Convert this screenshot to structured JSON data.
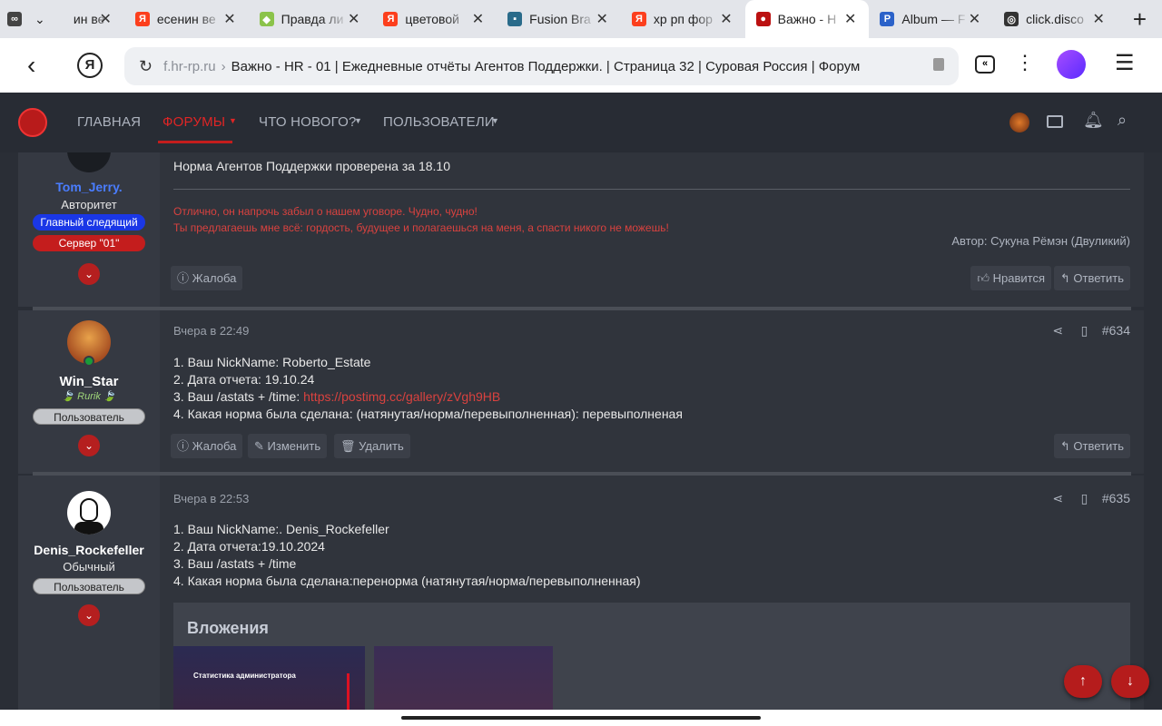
{
  "tabs": [
    {
      "title": "ин ве",
      "fav": "∞",
      "favbg": "#444"
    },
    {
      "title": "есенин ве",
      "fav": "Я",
      "favbg": "#fc3f1d"
    },
    {
      "title": "Правда ли",
      "fav": "◆",
      "favbg": "#8bc34a"
    },
    {
      "title": "цветовой",
      "fav": "Я",
      "favbg": "#fc3f1d"
    },
    {
      "title": "Fusion Bra",
      "fav": "▪",
      "favbg": "#2a6b8a"
    },
    {
      "title": "хр рп фор",
      "fav": "Я",
      "favbg": "#fc3f1d"
    },
    {
      "title": "Важно - Н",
      "fav": "●",
      "favbg": "#b11"
    },
    {
      "title": "Album — F",
      "fav": "P",
      "favbg": "#2b62c9"
    },
    {
      "title": "click.disco",
      "fav": "◎",
      "favbg": "#333"
    }
  ],
  "url": {
    "domain": "f.hr-rp.ru",
    "title": "Важно - HR - 01 | Ежедневные отчёты Агентов Поддержки. | Страница 32 | Суровая Россия | Форум"
  },
  "nav": {
    "home": "ГЛАВНАЯ",
    "forums": "ФОРУМЫ",
    "whatsnew": "ЧТО НОВОГО?",
    "users": "ПОЛЬЗОВАТЕЛИ"
  },
  "post1": {
    "user": "Tom_Jerry.",
    "title": "Авторитет",
    "badge1": "Главный следящий",
    "badge2": "Сервер \"01\"",
    "text": "Норма Агентов Поддержки проверена за 18.10",
    "sig1": "Отлично, он напрочь забыл о нашем уговоре. Чудно, чудно!",
    "sig2": "Ты предлагаешь мне всё: гордость, будущее и полагаешься на меня, а спасти никого не можешь!",
    "sig_author": "Автор: Сукуна Рёмэн (Двуликий)",
    "report": "Жалоба",
    "like": "Нравится",
    "reply": "Ответить"
  },
  "post2": {
    "user": "Win_Star",
    "title": "Rurik",
    "badge": "Пользователь",
    "date": "Вчера в 22:49",
    "num": "#634",
    "l1": "1. Ваш NickName: Roberto_Estate",
    "l2": "2. Дата отчета: 19.10.24",
    "l3": "3. Ваш /astats + /time: ",
    "link": "https://postimg.cc/gallery/zVgh9HB",
    "l4": "4. Какая норма была сделана: (натянутая/норма/перевыполненная): перевыполненая",
    "report": "Жалоба",
    "edit": "Изменить",
    "delete": "Удалить",
    "reply": "Ответить"
  },
  "post3": {
    "user": "Denis_Rockefeller",
    "title": "Обычный",
    "badge": "Пользователь",
    "date": "Вчера в 22:53",
    "num": "#635",
    "l1": "1. Ваш NickName:. Denis_Rockefeller",
    "l2": "2. Дата отчета:19.10.2024",
    "l3": "3. Ваш /astats + /time",
    "l4": "4. Какая норма была сделана:перенорма (натянутая/норма/перевыполненная)",
    "attachments": "Вложения",
    "img_caption": "Статистика администратора"
  }
}
